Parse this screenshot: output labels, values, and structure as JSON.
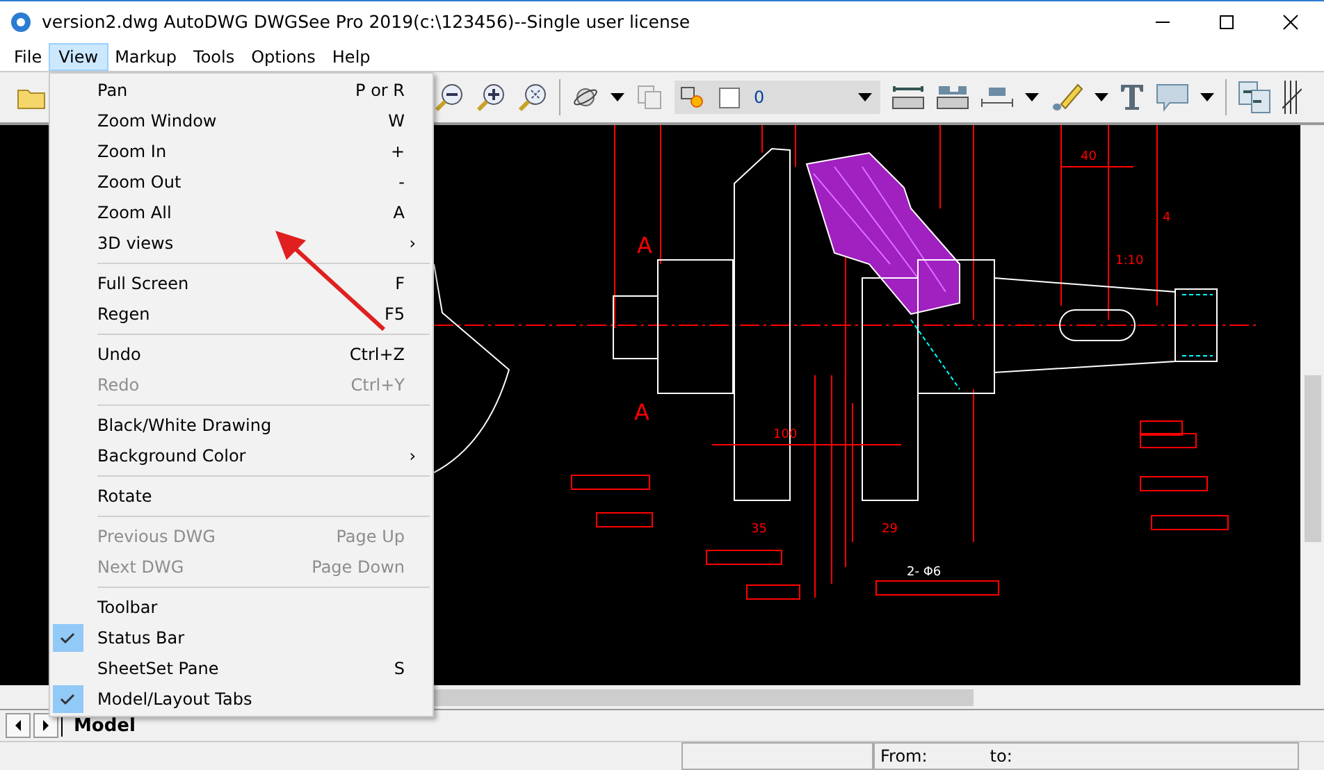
{
  "window": {
    "title": "version2.dwg AutoDWG DWGSee Pro 2019(c:\\123456)--Single user license"
  },
  "menu_bar": [
    {
      "label": "File",
      "selected": false
    },
    {
      "label": "View",
      "selected": true
    },
    {
      "label": "Markup",
      "selected": false
    },
    {
      "label": "Tools",
      "selected": false
    },
    {
      "label": "Options",
      "selected": false
    },
    {
      "label": "Help",
      "selected": false
    }
  ],
  "toolbar": {
    "layer": {
      "value": "0"
    }
  },
  "view_menu": {
    "sections": [
      {
        "items": [
          {
            "label": "Pan",
            "shortcut": "P or R",
            "disabled": false,
            "checked": false
          },
          {
            "label": "Zoom Window",
            "shortcut": "W",
            "disabled": false,
            "checked": false
          },
          {
            "label": "Zoom In",
            "shortcut": "+",
            "disabled": false,
            "checked": false
          },
          {
            "label": "Zoom Out",
            "shortcut": "-",
            "disabled": false,
            "checked": false
          },
          {
            "label": "Zoom All",
            "shortcut": "A",
            "disabled": false,
            "checked": false
          },
          {
            "label": "3D views",
            "submenu": "›",
            "disabled": false,
            "checked": false
          }
        ]
      },
      {
        "items": [
          {
            "label": "Full Screen",
            "shortcut": "F",
            "disabled": false,
            "checked": false
          },
          {
            "label": "Regen",
            "shortcut": "F5",
            "disabled": false,
            "checked": false
          }
        ]
      },
      {
        "items": [
          {
            "label": "Undo",
            "shortcut": "Ctrl+Z",
            "disabled": false,
            "checked": false
          },
          {
            "label": "Redo",
            "shortcut": "Ctrl+Y",
            "disabled": true,
            "checked": false
          }
        ]
      },
      {
        "items": [
          {
            "label": "Black/White Drawing",
            "disabled": false,
            "checked": false
          },
          {
            "label": "Background Color",
            "submenu": "›",
            "disabled": false,
            "checked": false
          }
        ]
      },
      {
        "items": [
          {
            "label": "Rotate",
            "disabled": false,
            "checked": false
          }
        ]
      },
      {
        "items": [
          {
            "label": "Previous DWG",
            "shortcut": "Page Up",
            "disabled": true,
            "checked": false
          },
          {
            "label": "Next DWG",
            "shortcut": "Page Down",
            "disabled": true,
            "checked": false
          }
        ]
      },
      {
        "items": [
          {
            "label": "Toolbar",
            "disabled": false,
            "checked": false
          },
          {
            "label": "Status Bar",
            "disabled": false,
            "checked": true
          },
          {
            "label": "SheetSet Pane",
            "shortcut": "S",
            "disabled": false,
            "checked": false
          },
          {
            "label": "Model/Layout Tabs",
            "disabled": false,
            "checked": true
          }
        ]
      }
    ]
  },
  "drawing": {
    "labels": [
      "A",
      "A",
      "40",
      "100",
      "35",
      "29",
      "2- Φ6",
      "1:10",
      "4"
    ]
  },
  "tabs": [
    {
      "label": "Model",
      "selected": true
    }
  ],
  "status_bar": {
    "from": "From:",
    "to": "to:"
  }
}
